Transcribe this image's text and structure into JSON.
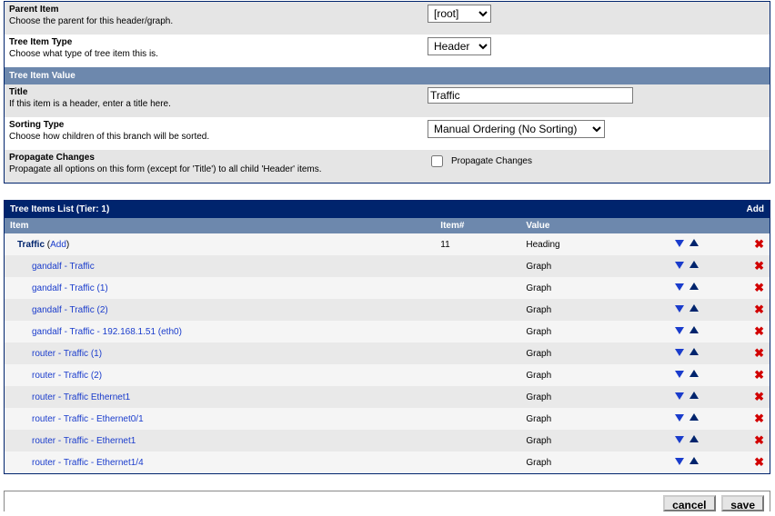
{
  "form": {
    "parent_item": {
      "label": "Parent Item",
      "help": "Choose the parent for this header/graph.",
      "selected": "[root]"
    },
    "tree_item_type": {
      "label": "Tree Item Type",
      "help": "Choose what type of tree item this is.",
      "selected": "Header"
    },
    "section_value": "Tree Item Value",
    "title_field": {
      "label": "Title",
      "help": "If this item is a header, enter a title here.",
      "value": "Traffic"
    },
    "sorting_type": {
      "label": "Sorting Type",
      "help": "Choose how children of this branch will be sorted.",
      "selected": "Manual Ordering (No Sorting)"
    },
    "propagate": {
      "label": "Propagate Changes",
      "help": "Propagate all options on this form (except for 'Title') to all child 'Header' items.",
      "checkbox_label": "Propagate Changes",
      "checked": false
    }
  },
  "list": {
    "title": "Tree Items List (Tier: 1)",
    "add_label": "Add",
    "columns": {
      "item": "Item",
      "num": "Item#",
      "value": "Value"
    },
    "rows": [
      {
        "label": "Traffic",
        "add": "Add",
        "num": "11",
        "value": "Heading",
        "indent": 1,
        "main": true
      },
      {
        "label": "gandalf - Traffic",
        "value": "Graph",
        "indent": 2
      },
      {
        "label": "gandalf - Traffic (1)",
        "value": "Graph",
        "indent": 2
      },
      {
        "label": "gandalf - Traffic (2)",
        "value": "Graph",
        "indent": 2
      },
      {
        "label": "gandalf - Traffic - 192.168.1.51 (eth0)",
        "value": "Graph",
        "indent": 2
      },
      {
        "label": "router - Traffic (1)",
        "value": "Graph",
        "indent": 2
      },
      {
        "label": "router - Traffic (2)",
        "value": "Graph",
        "indent": 2
      },
      {
        "label": "router - Traffic Ethernet1",
        "value": "Graph",
        "indent": 2
      },
      {
        "label": "router - Traffic - Ethernet0/1",
        "value": "Graph",
        "indent": 2
      },
      {
        "label": "router - Traffic - Ethernet1",
        "value": "Graph",
        "indent": 2
      },
      {
        "label": "router - Traffic - Ethernet1/4",
        "value": "Graph",
        "indent": 2
      }
    ]
  },
  "buttons": {
    "cancel": "cancel",
    "save": "save"
  }
}
